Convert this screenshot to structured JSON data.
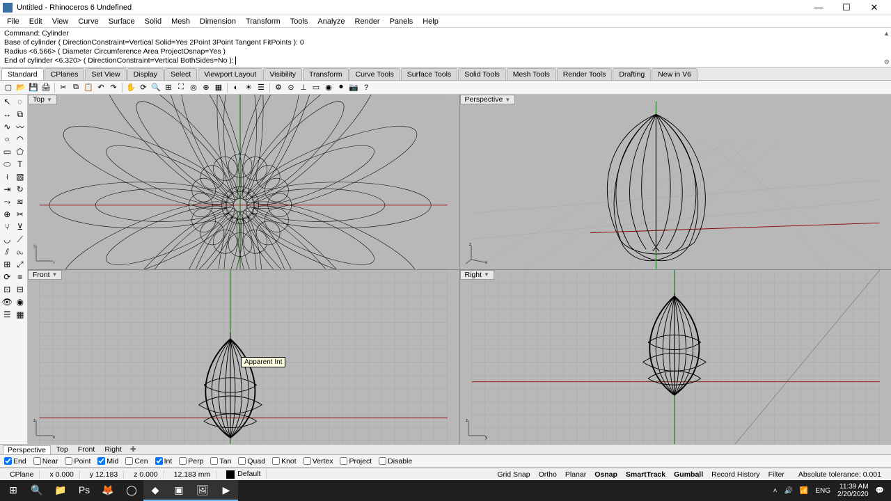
{
  "window": {
    "title": "Untitled - Rhinoceros 6 Undefined"
  },
  "menu": [
    "File",
    "Edit",
    "View",
    "Curve",
    "Surface",
    "Solid",
    "Mesh",
    "Dimension",
    "Transform",
    "Tools",
    "Analyze",
    "Render",
    "Panels",
    "Help"
  ],
  "command_history": [
    "Command: Cylinder",
    "Base of cylinder ( DirectionConstraint=Vertical  Solid=Yes  2Point  3Point  Tangent  FitPoints ): 0",
    "Radius <6.566> ( Diameter  Circumference  Area  ProjectOsnap=Yes )"
  ],
  "command_current": "End of cylinder <6.320> ( DirectionConstraint=Vertical  BothSides=No ): ",
  "ribbon_tabs": [
    "Standard",
    "CPlanes",
    "Set View",
    "Display",
    "Select",
    "Viewport Layout",
    "Visibility",
    "Transform",
    "Curve Tools",
    "Surface Tools",
    "Solid Tools",
    "Mesh Tools",
    "Render Tools",
    "Drafting",
    "New in V6"
  ],
  "toolbar_icons": [
    "new",
    "open",
    "save",
    "print",
    "cut",
    "copy",
    "paste",
    "undo",
    "redo",
    "pan",
    "rotate-view",
    "zoom-dynamic",
    "zoom-window",
    "zoom-extents",
    "zoom-selected",
    "zoom-target",
    "set-view",
    "shade",
    "render",
    "layers",
    "properties",
    "object-snap",
    "ortho",
    "planar",
    "osnap",
    "record",
    "snapshot",
    "help"
  ],
  "side_tools": [
    "pointer",
    "lasso",
    "move",
    "copy",
    "polyline",
    "curve",
    "circle",
    "arc",
    "rectangle",
    "polygon",
    "ellipse",
    "text",
    "dimension",
    "hatch",
    "extrude",
    "revolve",
    "sweep",
    "loft",
    "boolean",
    "trim",
    "split",
    "join",
    "fillet",
    "chamfer",
    "offset",
    "mirror",
    "array",
    "scale",
    "rotate",
    "align",
    "group",
    "ungroup",
    "hide",
    "show",
    "layer",
    "block"
  ],
  "viewports": {
    "top": {
      "label": "Top"
    },
    "perspective": {
      "label": "Perspective"
    },
    "front": {
      "label": "Front"
    },
    "right": {
      "label": "Right"
    }
  },
  "tooltip": "Apparent Int",
  "bottom_view_tabs": [
    "Perspective",
    "Top",
    "Front",
    "Right"
  ],
  "osnap": {
    "End": true,
    "Near": false,
    "Point": false,
    "Mid": true,
    "Cen": false,
    "Int": true,
    "Perp": false,
    "Tan": false,
    "Quad": false,
    "Knot": false,
    "Vertex": false,
    "Project": false,
    "Disable": false
  },
  "status": {
    "cplane": "CPlane",
    "x": "x 0.000",
    "y": "y 12.183",
    "z": "z 0.000",
    "dist": "12.183 mm",
    "layer": "Default",
    "toggles": [
      "Grid Snap",
      "Ortho",
      "Planar",
      "Osnap",
      "SmartTrack",
      "Gumball",
      "Record History",
      "Filter"
    ],
    "toggles_bold": [
      "Osnap",
      "SmartTrack",
      "Gumball"
    ],
    "tolerance": "Absolute tolerance: 0.001"
  },
  "taskbar": {
    "items": [
      "start",
      "search",
      "explorer",
      "photoshop",
      "firefox",
      "app1",
      "app2",
      "app3",
      "photos",
      "camtasia"
    ],
    "tray": {
      "lang": "ENG",
      "time": "11:39 AM",
      "date": "2/20/2020"
    }
  }
}
